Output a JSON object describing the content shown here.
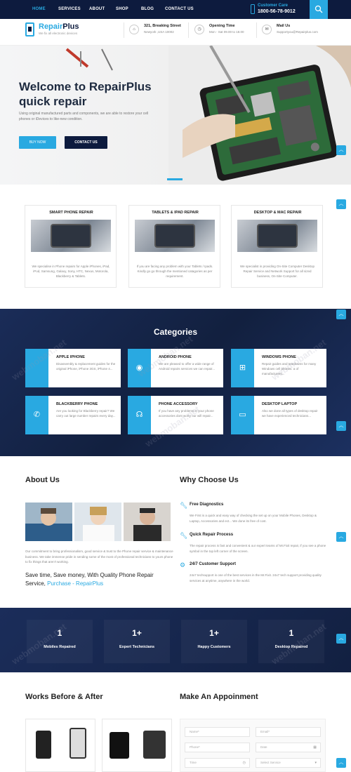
{
  "nav": {
    "items": [
      "HOME",
      "SERVICES",
      "ABOUT",
      "SHOP",
      "BLOG",
      "CONTACT US"
    ],
    "customer_care_label": "Customer Care",
    "customer_care_number": "1800-56-78-9012",
    "accent": "#29a9e1",
    "dark": "#0d1b3e"
  },
  "header": {
    "logo_part1": "Repair",
    "logo_part2": "Plus",
    "tagline": "We fix all electronic devices",
    "info": [
      {
        "icon": "home-icon",
        "title": "321, Breaking Street",
        "sub": "Newyork ,USA 10002"
      },
      {
        "icon": "clock-icon",
        "title": "Opening Time",
        "sub": "Mon - Sat 09.00 to 18.00"
      },
      {
        "icon": "mail-icon",
        "title": "Mail Us",
        "sub": "Supportyou@Repairplus.com"
      }
    ]
  },
  "hero": {
    "title_line1": "Welcome to RepairPlus",
    "title_line2": "quick repair",
    "desc": "Using original manufactured parts and components, we are able to restore your cell phones or iDevices to like-new condition.",
    "buy_label": "BUY NOW",
    "contact_label": "CONTACT US"
  },
  "services": [
    {
      "title": "SMART PHONE REPAIR",
      "desc": "We specialise in Phone repairs for Apple iPhones, iPad, iPod, Samsung, Galaxy, Sony, HTC, Nexus, Motorola, Blackberry & Tablets."
    },
    {
      "title": "TABLETS & IPAD REPAIR",
      "desc": "If you are facing any problem with your Tablets / Ipads. Kindly go go through the mentioned catagories as per requirement."
    },
    {
      "title": "DESKTOP & MAC REPAIR",
      "desc": "We specialist in providing On-Site Computer Desktop Repair Service and Network Support for all sized business, On-Site Computer."
    }
  ],
  "categories": {
    "heading": "Categories",
    "items": [
      {
        "icon": "apple-icon",
        "title": "APPLE IPHONE",
        "desc": "Disassembly & replacement guides for the original iPhone, iPhone 3GS, iPhone 4..."
      },
      {
        "icon": "android-icon",
        "title": "ANDROID PHONE",
        "desc": "We are pleased to offer a wide range of Android repairs services we can repair..."
      },
      {
        "icon": "windows-icon",
        "title": "WINDOWS PHONE",
        "desc": "Repair guides and teardowns for many Windows cell phones. a of manufacturers..."
      },
      {
        "icon": "phone-icon",
        "title": "BLACKBERRY PHONE",
        "desc": "Are you looking for Blackberry repair? We carry out large number repairs every day..."
      },
      {
        "icon": "headphones-icon",
        "title": "PHONE ACCESSORY",
        "desc": "If you have any problems in your phone accessories dont worry our will repair..."
      },
      {
        "icon": "laptop-icon",
        "title": "DESKTOP LAPTOP",
        "desc": "Also we done all types of desktop repair we have experienced technicians..."
      }
    ]
  },
  "about": {
    "heading": "About Us",
    "desc": "Our commitment to bring professionalism, good service & trust to the Phone repair service & maintenance business. We take immense pride in sending some of the most of professional technicians to yours phone to fix things that aren't working.",
    "save_text": "Save time, Save money, With Quality Phone Repair Service,",
    "save_link": "Purchase - RepairPlus"
  },
  "why": {
    "heading": "Why Choose Us",
    "items": [
      {
        "icon": "wrench-icon",
        "title": "Free Diagnostics",
        "desc": "We First is a quick and easy way of checking the set up on your Mobile Phones, Desktop & Laptop, Accessories and ect... We done its free of cost."
      },
      {
        "icon": "wrench-icon",
        "title": "Quick Repair Process",
        "desc": "The repair process is fast and convenient & our expert teams of Mr.Fixit repair, if you see a phone symbol in the top left corner of the screen."
      },
      {
        "icon": "support-icon",
        "title": "24/7 Customer Support",
        "desc": "24x7 techsupport is one of the best services in the Mr.Fixit. 24x7 tech support providing quality services at anytime, anywhere in the world."
      }
    ]
  },
  "counters": [
    {
      "num": "1",
      "label": "Mobiles Repaired"
    },
    {
      "num": "1+",
      "label": "Expert Technicians"
    },
    {
      "num": "1+",
      "label": "Happy Customers"
    },
    {
      "num": "1",
      "label": "Desktop Repaired"
    }
  ],
  "works": {
    "heading": "Works Before & After"
  },
  "appointment": {
    "heading": "Make An Appoinment",
    "fields": {
      "name": "Name*",
      "email": "Email*",
      "phone": "Phone*",
      "date": "Date",
      "time": "Time",
      "service": "Select Service"
    }
  },
  "watermark": "webmoban.net"
}
